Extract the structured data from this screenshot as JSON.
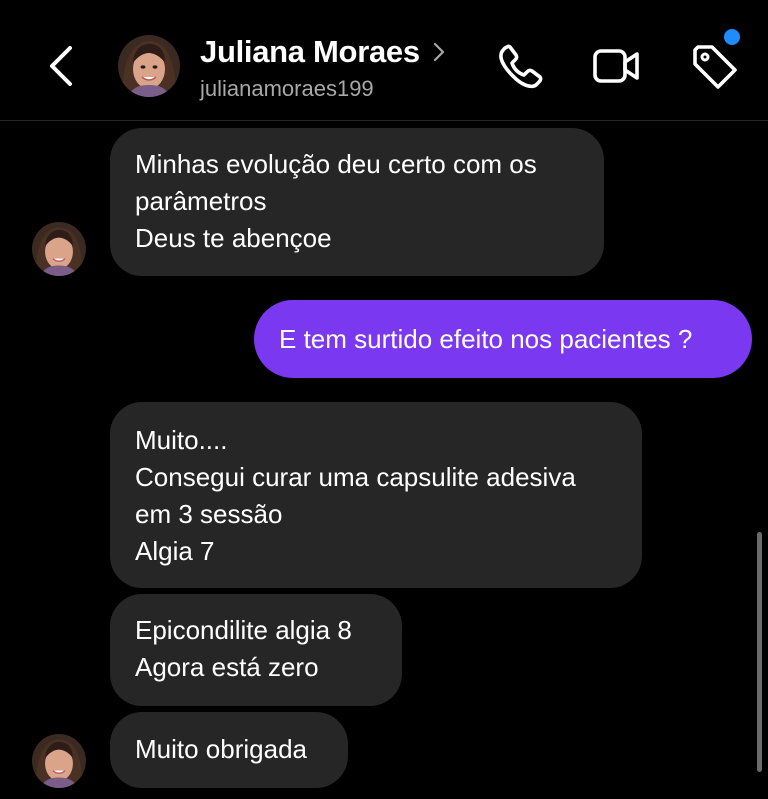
{
  "header": {
    "name": "Juliana Moraes",
    "username": "julianamoraes199",
    "icons": [
      "back-icon",
      "chevron-right-icon",
      "phone-icon",
      "video-camera-icon",
      "tag-icon"
    ],
    "notification_color": "#1f8bff"
  },
  "messages": [
    {
      "from": "them",
      "lines": [
        "Minhas evolução deu certo com os",
        "parâmetros",
        "Deus te abençoe"
      ]
    },
    {
      "from": "me",
      "lines": [
        "E tem surtido efeito nos pacientes ?"
      ]
    },
    {
      "from": "them",
      "lines": [
        "Muito....",
        "Consegui curar uma capsulite adesiva",
        "em 3 sessão",
        "Algia 7"
      ]
    },
    {
      "from": "them",
      "lines": [
        "Epicondilite algia 8",
        "Agora está zero"
      ]
    },
    {
      "from": "them",
      "lines": [
        "Muito obrigada"
      ]
    }
  ],
  "colors": {
    "background": "#000000",
    "received_bubble": "#262626",
    "sent_bubble": "#7a39f0"
  }
}
